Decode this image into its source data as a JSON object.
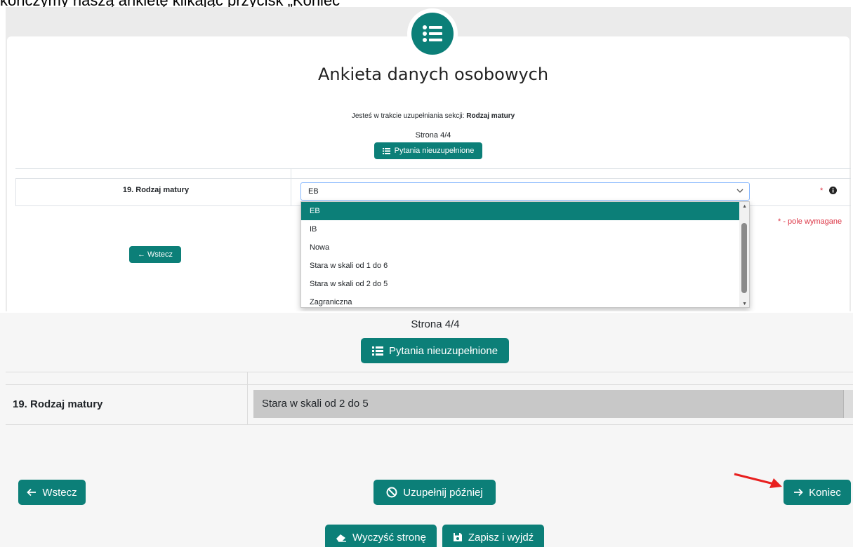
{
  "caption": "kończymy naszą ankietę klikając przycisk „Koniec”",
  "top": {
    "title": "Ankieta danych osobowych",
    "section_prefix": "Jesteś w trakcie uzupełniania sekcji: ",
    "section_name": "Rodzaj matury",
    "page_label": "Strona 4/4",
    "unfilled_button": "Pytania nieuzupełnione",
    "question": "19. Rodzaj matury",
    "select_value": "EB",
    "required_star": "*",
    "required_note": "* - pole wymagane",
    "back_button": "← Wstecz",
    "options": [
      "EB",
      "IB",
      "Nowa",
      "Stara w skali od 1 do 6",
      "Stara w skali od 2 do 5",
      "Zagraniczna"
    ],
    "selected_option": "EB"
  },
  "bottom": {
    "page_label": "Strona 4/4",
    "unfilled_button": "Pytania nieuzupełnione",
    "question": "19. Rodzaj matury",
    "select_value": "Stara w skali od 2 do 5",
    "back_button": "Wstecz",
    "later_button": "Uzupełnij później",
    "finish_button": "Koniec",
    "clear_button": "Wyczyść stronę",
    "save_button": "Zapisz i wyjdź"
  },
  "colors": {
    "accent": "#0c7f78",
    "required": "#dc3545",
    "annotation_arrow": "#e8201f"
  },
  "icons": [
    "list-icon",
    "chevron-down-icon",
    "info-icon",
    "arrow-left-icon",
    "arrow-right-icon",
    "ban-icon",
    "eraser-icon",
    "floppy-disk-icon"
  ]
}
